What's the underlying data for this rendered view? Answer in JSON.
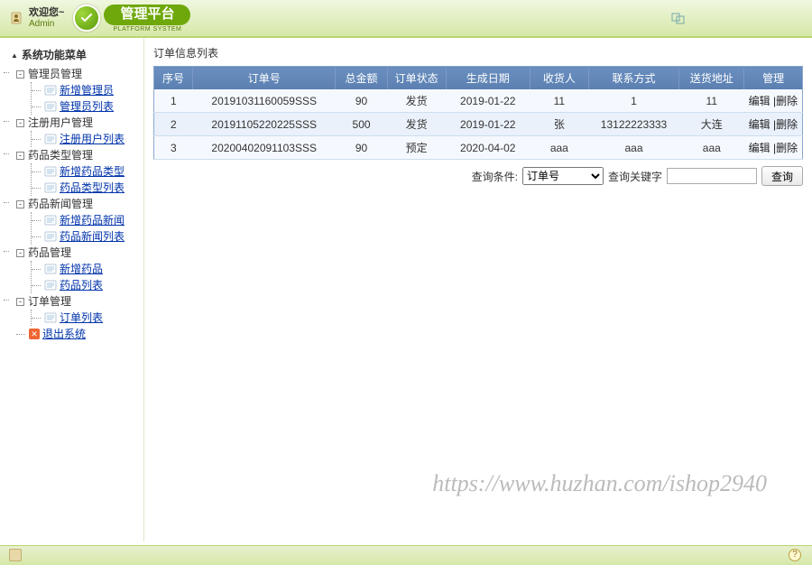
{
  "header": {
    "welcome_label": "欢迎您~",
    "user": "Admin",
    "brand": "管理平台",
    "brand_sub": "PLATFORM SYSTEM"
  },
  "sidebar": {
    "root": "系统功能菜单",
    "folders": [
      {
        "label": "管理员管理",
        "children": [
          {
            "label": "新增管理员"
          },
          {
            "label": "管理员列表"
          }
        ]
      },
      {
        "label": "注册用户管理",
        "children": [
          {
            "label": "注册用户列表"
          }
        ]
      },
      {
        "label": "药品类型管理",
        "children": [
          {
            "label": "新增药品类型"
          },
          {
            "label": "药品类型列表"
          }
        ]
      },
      {
        "label": "药品新闻管理",
        "children": [
          {
            "label": "新增药品新闻"
          },
          {
            "label": "药品新闻列表"
          }
        ]
      },
      {
        "label": "药品管理",
        "children": [
          {
            "label": "新增药品"
          },
          {
            "label": "药品列表"
          }
        ]
      },
      {
        "label": "订单管理",
        "children": [
          {
            "label": "订单列表"
          }
        ]
      }
    ],
    "exit": "退出系统"
  },
  "panel": {
    "title": "订单信息列表",
    "columns": [
      "序号",
      "订单号",
      "总金额",
      "订单状态",
      "生成日期",
      "收货人",
      "联系方式",
      "送货地址",
      "管理"
    ],
    "rows": [
      {
        "idx": "1",
        "no": "20191031160059SSS",
        "amt": "90",
        "status": "发货",
        "date": "2019-01-22",
        "recv": "11",
        "phone": "1",
        "addr": "11"
      },
      {
        "idx": "2",
        "no": "20191105220225SSS",
        "amt": "500",
        "status": "发货",
        "date": "2019-01-22",
        "recv": "张",
        "phone": "13122223333",
        "addr": "大连"
      },
      {
        "idx": "3",
        "no": "20200402091103SSS",
        "amt": "90",
        "status": "预定",
        "date": "2020-04-02",
        "recv": "aaa",
        "phone": "aaa",
        "addr": "aaa"
      }
    ],
    "action_edit": "编辑",
    "action_sep": "|",
    "action_del": "删除"
  },
  "search": {
    "field_label": "查询条件:",
    "field_options": [
      "订单号"
    ],
    "keyword_label": "查询关键字",
    "button": "查询"
  },
  "watermark": "https://www.huzhan.com/ishop2940",
  "footer": {
    "help": "?"
  }
}
